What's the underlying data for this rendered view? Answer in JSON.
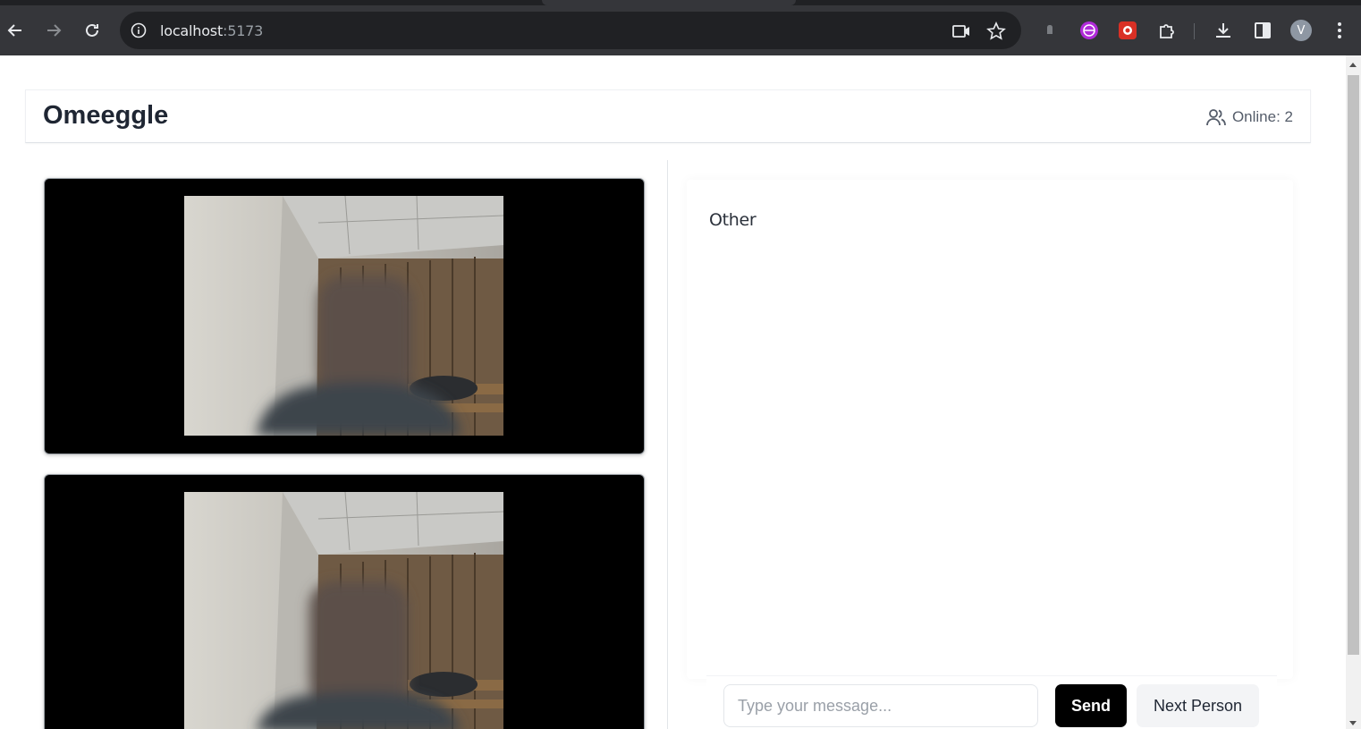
{
  "browser": {
    "url_host": "localhost",
    "url_port": ":5173",
    "profile_initial": "V",
    "icons": {
      "back": "back-arrow-icon",
      "forward": "forward-arrow-icon",
      "reload": "reload-icon",
      "site_info": "info-icon",
      "camera": "camera-icon",
      "bookmark": "star-icon",
      "extensions": [
        "extension-shield-icon",
        "extension-globe-icon",
        "extension-red-icon",
        "extensions-puzzle-icon"
      ],
      "download": "download-icon",
      "side_panel": "side-panel-icon",
      "menu": "kebab-menu-icon"
    }
  },
  "header": {
    "title": "Omeeggle",
    "online_label": "Online: 2",
    "online_icon": "users-icon"
  },
  "videos": [
    {
      "name": "remote-video"
    },
    {
      "name": "local-video"
    }
  ],
  "chat": {
    "sender_label": "Other",
    "messages": [],
    "input_placeholder": "Type your message...",
    "input_value": "",
    "send_label": "Send",
    "next_label": "Next Person"
  },
  "colors": {
    "chrome_bg": "#35363a",
    "omnibox_bg": "#202124",
    "send_bg": "#000000",
    "next_bg": "#f3f4f6",
    "video_bg": "#000000"
  }
}
